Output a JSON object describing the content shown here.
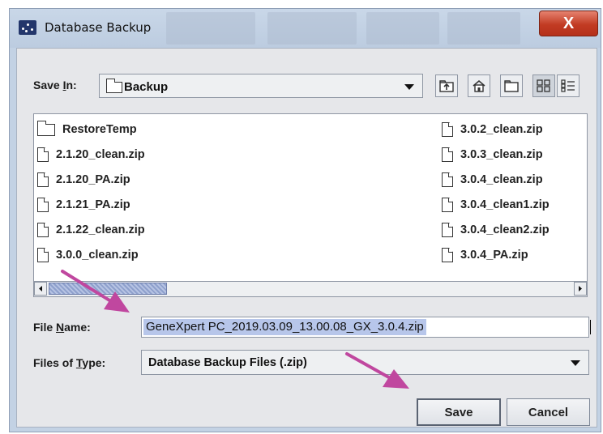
{
  "window": {
    "title": "Database Backup",
    "close_label": "X"
  },
  "toolbar": {
    "save_in_label_pre": "Save ",
    "save_in_label_key": "I",
    "save_in_label_post": "n:",
    "location": "Backup",
    "buttons": [
      {
        "name": "up-folder-icon"
      },
      {
        "name": "home-icon"
      },
      {
        "name": "new-folder-icon"
      },
      {
        "name": "list-view-icon"
      },
      {
        "name": "details-view-icon"
      }
    ]
  },
  "files": {
    "column1": [
      {
        "name": "RestoreTemp",
        "type": "folder"
      },
      {
        "name": "2.1.20_clean.zip",
        "type": "file"
      },
      {
        "name": "2.1.20_PA.zip",
        "type": "file"
      },
      {
        "name": "2.1.21_PA.zip",
        "type": "file"
      },
      {
        "name": "2.1.22_clean.zip",
        "type": "file"
      },
      {
        "name": "3.0.0_clean.zip",
        "type": "file"
      }
    ],
    "column2": [
      {
        "name": "3.0.2_clean.zip",
        "type": "file"
      },
      {
        "name": "3.0.3_clean.zip",
        "type": "file"
      },
      {
        "name": "3.0.4_clean.zip",
        "type": "file"
      },
      {
        "name": "3.0.4_clean1.zip",
        "type": "file"
      },
      {
        "name": "3.0.4_clean2.zip",
        "type": "file"
      },
      {
        "name": "3.0.4_PA.zip",
        "type": "file"
      }
    ]
  },
  "form": {
    "file_name_label_pre": "File ",
    "file_name_label_key": "N",
    "file_name_label_post": "ame:",
    "file_name_value": "GeneXpert PC_2019.03.09_13.00.08_GX_3.0.4.zip",
    "files_of_type_label_pre": "Files of ",
    "files_of_type_label_key": "T",
    "files_of_type_label_post": "ype:",
    "files_of_type_value": "Database Backup Files (.zip)"
  },
  "actions": {
    "save_label": "Save",
    "cancel_label": "Cancel"
  },
  "colors": {
    "annotation_arrow": "#c0479f",
    "selection": "#b7c6ea",
    "close_button": "#c23b23"
  }
}
